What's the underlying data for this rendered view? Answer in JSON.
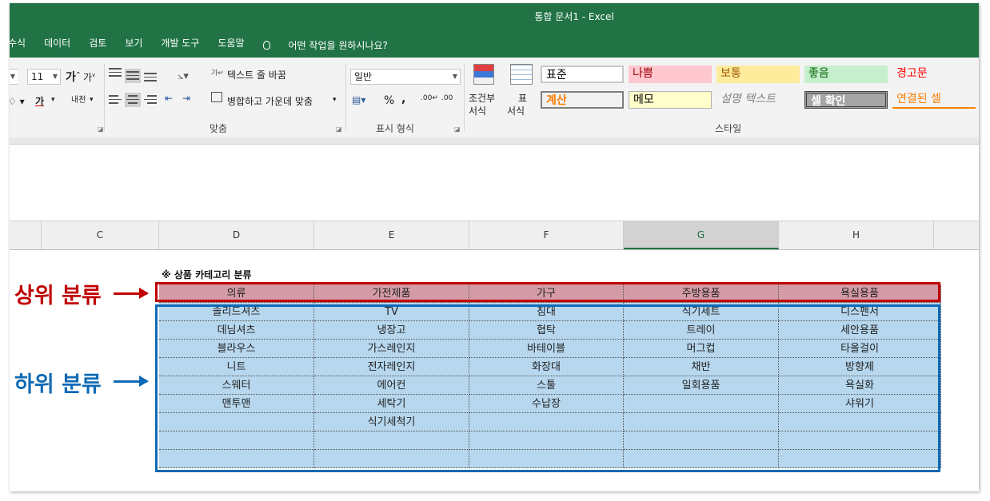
{
  "window": {
    "title": "통합 문서1  -  Excel"
  },
  "menu": [
    "수식",
    "데이터",
    "검토",
    "보기",
    "개발 도구",
    "도움말"
  ],
  "tell_me": "어떤 작업을 원하시나요?",
  "ribbon": {
    "font_size": "11",
    "wrap_text": "텍스트 줄 바꿈",
    "merge_center": "병합하고 가운데 맞춤",
    "number_format": "일반",
    "percent": "%",
    "comma": ",",
    "cond_format_1": "조건부",
    "cond_format_2": "서식",
    "table_format_1": "표",
    "table_format_2": "서식",
    "groups": {
      "alignment": "맞춤",
      "number": "표시 형식",
      "styles": "스타일"
    },
    "styles": {
      "normal": "표준",
      "bad": "나쁨",
      "neutral": "보통",
      "good": "좋음",
      "warning": "경고문",
      "calc": "계산",
      "memo": "메모",
      "explanatory": "설명 텍스트",
      "check": "셀 확인",
      "linked": "연결된 셀"
    },
    "colors": {
      "bad_bg": "#ffc7ce",
      "bad_fg": "#9c0006",
      "neutral_bg": "#ffeb9c",
      "neutral_fg": "#9c5700",
      "good_bg": "#c6efce",
      "good_fg": "#006100",
      "warning_fg": "#ff0000",
      "calc_fg": "#fa7d00",
      "check_bg": "#a5a5a5",
      "linked_fg": "#fa7d00"
    }
  },
  "columns": [
    "C",
    "D",
    "E",
    "F",
    "G",
    "H"
  ],
  "selected_column": "G",
  "sheet": {
    "caption": "※ 상품 카테고리 분류",
    "header": [
      "의류",
      "가전제품",
      "가구",
      "주방용품",
      "욕실용품"
    ],
    "rows": [
      [
        "솔리드셔츠",
        "TV",
        "침대",
        "식기세트",
        "디스펜서"
      ],
      [
        "데님셔츠",
        "냉장고",
        "협탁",
        "트레이",
        "세안용품"
      ],
      [
        "블라우스",
        "가스레인지",
        "바테이블",
        "머그컵",
        "타올걸이"
      ],
      [
        "니트",
        "전자레인지",
        "화장대",
        "채반",
        "방향제"
      ],
      [
        "스웨터",
        "에어컨",
        "스툴",
        "일회용품",
        "욕실화"
      ],
      [
        "맨투맨",
        "세탁기",
        "수납장",
        "",
        "샤워기"
      ],
      [
        "",
        "식기세척기",
        "",
        "",
        ""
      ],
      [
        "",
        "",
        "",
        "",
        ""
      ],
      [
        "",
        "",
        "",
        "",
        ""
      ]
    ]
  },
  "annotations": {
    "upper": "상위 분류",
    "lower": "하위 분류"
  },
  "colors": {
    "accent": "#217346",
    "upper": "#c00000",
    "lower": "#0f6ab5",
    "header_fill": "#d49ba6",
    "sub_fill": "#b6d7ee"
  }
}
